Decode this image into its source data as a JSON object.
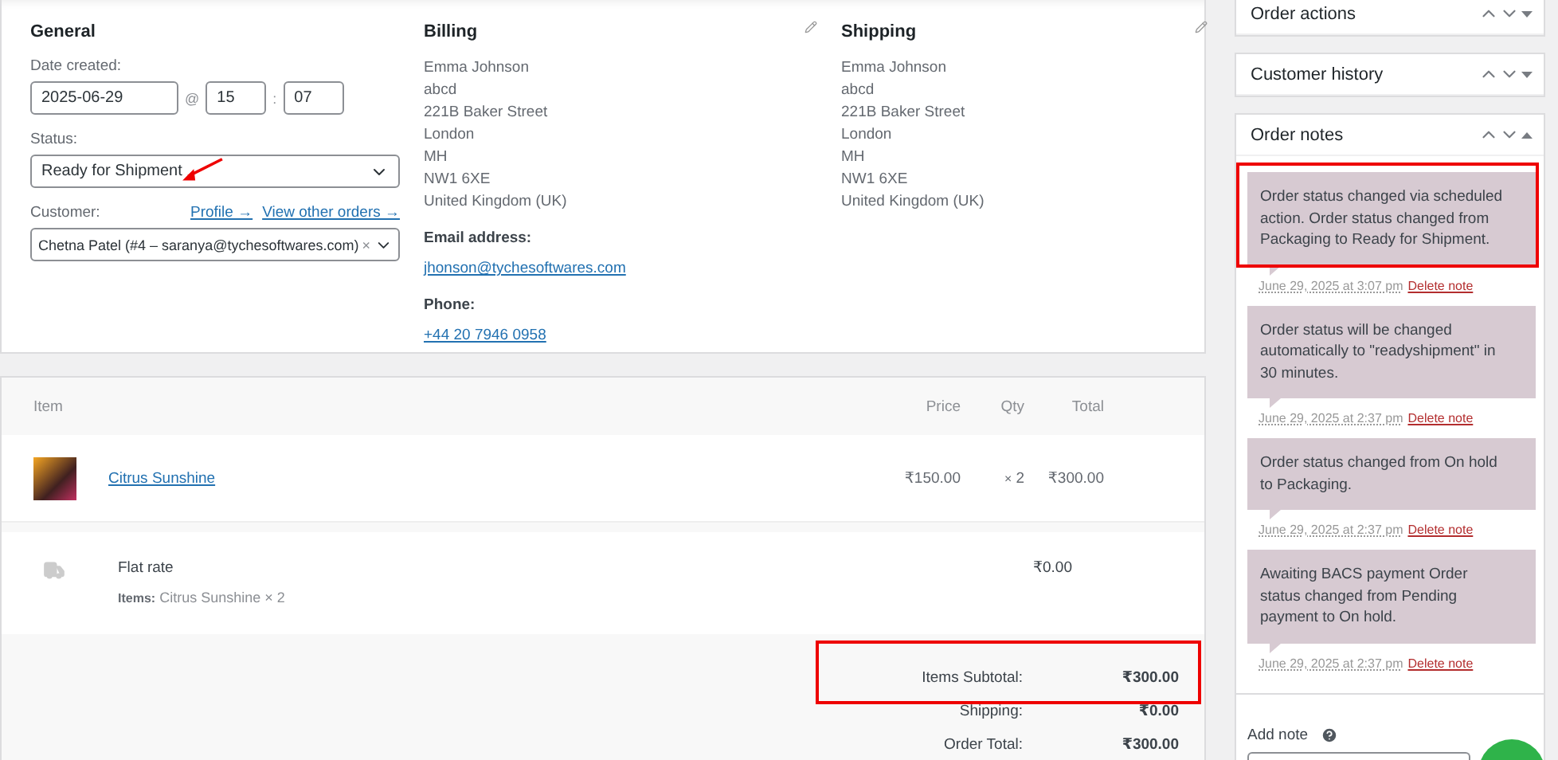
{
  "general": {
    "title": "General",
    "date_label": "Date created:",
    "date": "2025-06-29",
    "at": "@",
    "hour": "15",
    "colon": ":",
    "minute": "07",
    "status_label": "Status:",
    "status": "Ready for Shipment",
    "status_annotated": true,
    "customer_label": "Customer:",
    "profile_link": "Profile →",
    "orders_link": "View other orders →",
    "customer": "Chetna Patel (#4 – saranya@tychesoftwares.com)",
    "clear": "×"
  },
  "billing": {
    "title": "Billing",
    "lines": [
      "Emma Johnson",
      "abcd",
      "221B Baker Street",
      "London",
      "MH",
      "NW1 6XE",
      "United Kingdom (UK)"
    ],
    "email_label": "Email address:",
    "email": "jhonson@tychesoftwares.com",
    "phone_label": "Phone:",
    "phone": "+44 20 7946 0958"
  },
  "shipping": {
    "title": "Shipping",
    "lines": [
      "Emma Johnson",
      "abcd",
      "221B Baker Street",
      "London",
      "MH",
      "NW1 6XE",
      "United Kingdom (UK)"
    ]
  },
  "items": {
    "columns": [
      "Item",
      "Price",
      "Qty",
      "Total"
    ],
    "rows": [
      {
        "name": "Citrus Sunshine",
        "price": "₹150.00",
        "qty_sign": "×",
        "qty": "2",
        "total": "₹300.00"
      }
    ],
    "shipping_line": {
      "name": "Flat rate",
      "items_label": "Items:",
      "items": "Citrus Sunshine × 2",
      "total": "₹0.00"
    },
    "totals": [
      {
        "label": "Items Subtotal:",
        "value": "₹300.00",
        "highlighted": true
      },
      {
        "label": "Shipping:",
        "value": "₹0.00",
        "highlighted": false
      },
      {
        "label": "Order Total:",
        "value": "₹300.00",
        "highlighted": false
      }
    ]
  },
  "sidebar": {
    "panels": [
      {
        "title": "Order actions"
      },
      {
        "title": "Customer history"
      }
    ],
    "notes_title": "Order notes",
    "notes": [
      {
        "text": "Order status changed via scheduled action. Order status changed from Packaging to Ready for Shipment.",
        "date": "June 29, 2025 at 3:07 pm",
        "delete": "Delete note",
        "highlighted": true
      },
      {
        "text": "Order status will be changed automatically to \"readyshipment\" in 30 minutes.",
        "date": "June 29, 2025 at 2:37 pm",
        "delete": "Delete note",
        "highlighted": false
      },
      {
        "text": "Order status changed from On hold to Packaging.",
        "date": "June 29, 2025 at 2:37 pm",
        "delete": "Delete note",
        "highlighted": false
      },
      {
        "text": "Awaiting BACS payment Order status changed from Pending payment to On hold.",
        "date": "June 29, 2025 at 2:37 pm",
        "delete": "Delete note",
        "highlighted": false
      }
    ],
    "add_note_label": "Add note"
  }
}
